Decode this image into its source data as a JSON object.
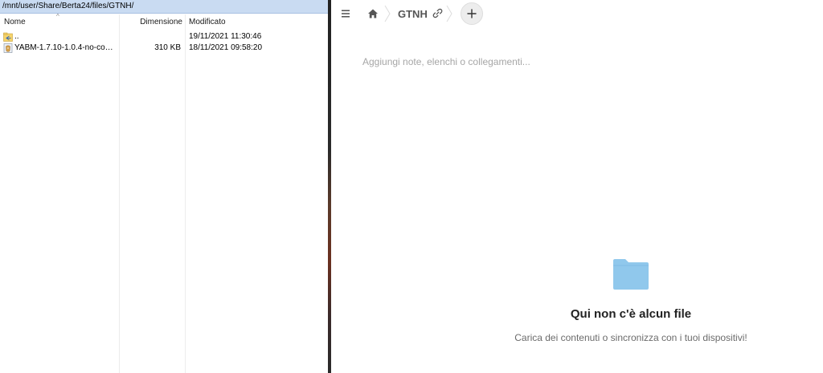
{
  "file_manager": {
    "path": "/mnt/user/Share/Berta24/files/GTNH/",
    "columns": {
      "name": "Nome",
      "size": "Dimensione",
      "modified": "Modificato"
    },
    "rows": [
      {
        "name": "..",
        "size": "",
        "modified": "19/11/2021 11:30:46",
        "icon": "parent-folder-icon"
      },
      {
        "name": "YABM-1.7.10-1.0.4-no-compr...",
        "size": "310 KB",
        "modified": "18/11/2021 09:58:20",
        "icon": "jar-file-icon"
      }
    ]
  },
  "nextcloud": {
    "breadcrumb": {
      "current": "GTNH"
    },
    "notes_placeholder": "Aggiungi note, elenchi o collegamenti...",
    "empty_state": {
      "title": "Qui non c'è alcun file",
      "subtitle": "Carica dei contenuti o sincronizza con i tuoi dispositivi!"
    },
    "colors": {
      "folder": "#90c8ec",
      "accent_gray": "#ededed"
    }
  }
}
